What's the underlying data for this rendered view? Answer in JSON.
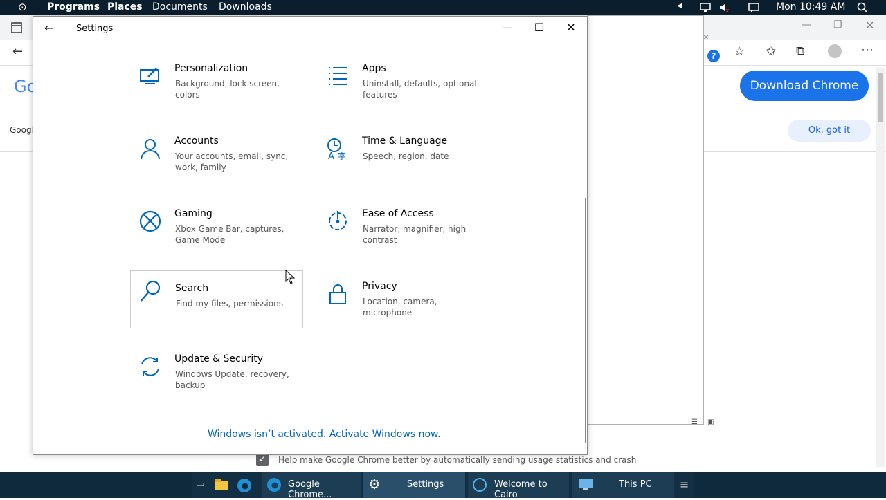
{
  "topbar": {
    "menus": [
      "Programs",
      "Places",
      "Documents",
      "Downloads"
    ],
    "clock": "Mon 10:49 AM"
  },
  "chrome": {
    "download_label": "Download Chrome",
    "ok_label": "Ok, got it",
    "logo_partial": "Go",
    "tab_partial": "Googl",
    "help_line": "Help make Google Chrome better by automatically sending usage statistics and crash"
  },
  "settings": {
    "title": "Settings",
    "tiles": [
      {
        "name": "Personalization",
        "desc": "Background, lock screen, colors"
      },
      {
        "name": "Apps",
        "desc": "Uninstall, defaults, optional features"
      },
      {
        "name": "Accounts",
        "desc": "Your accounts, email, sync, work, family"
      },
      {
        "name": "Time & Language",
        "desc": "Speech, region, date"
      },
      {
        "name": "Gaming",
        "desc": "Xbox Game Bar, captures, Game Mode"
      },
      {
        "name": "Ease of Access",
        "desc": "Narrator, magnifier, high contrast"
      },
      {
        "name": "Search",
        "desc": "Find my files, permissions"
      },
      {
        "name": "Privacy",
        "desc": "Location, camera, microphone"
      },
      {
        "name": "Update & Security",
        "desc": "Windows Update, recovery, backup"
      }
    ],
    "activate_link": "Windows isn’t activated. Activate Windows now."
  },
  "taskbar": {
    "items": [
      {
        "label": "Google Chrome..."
      },
      {
        "label": "Settings"
      },
      {
        "label": "Welcome to Cairo"
      },
      {
        "label": "This PC"
      }
    ]
  },
  "colors": {
    "accent": "#0067b8",
    "chrome_blue": "#1a73e8",
    "taskbar": "#0f2a3d"
  }
}
